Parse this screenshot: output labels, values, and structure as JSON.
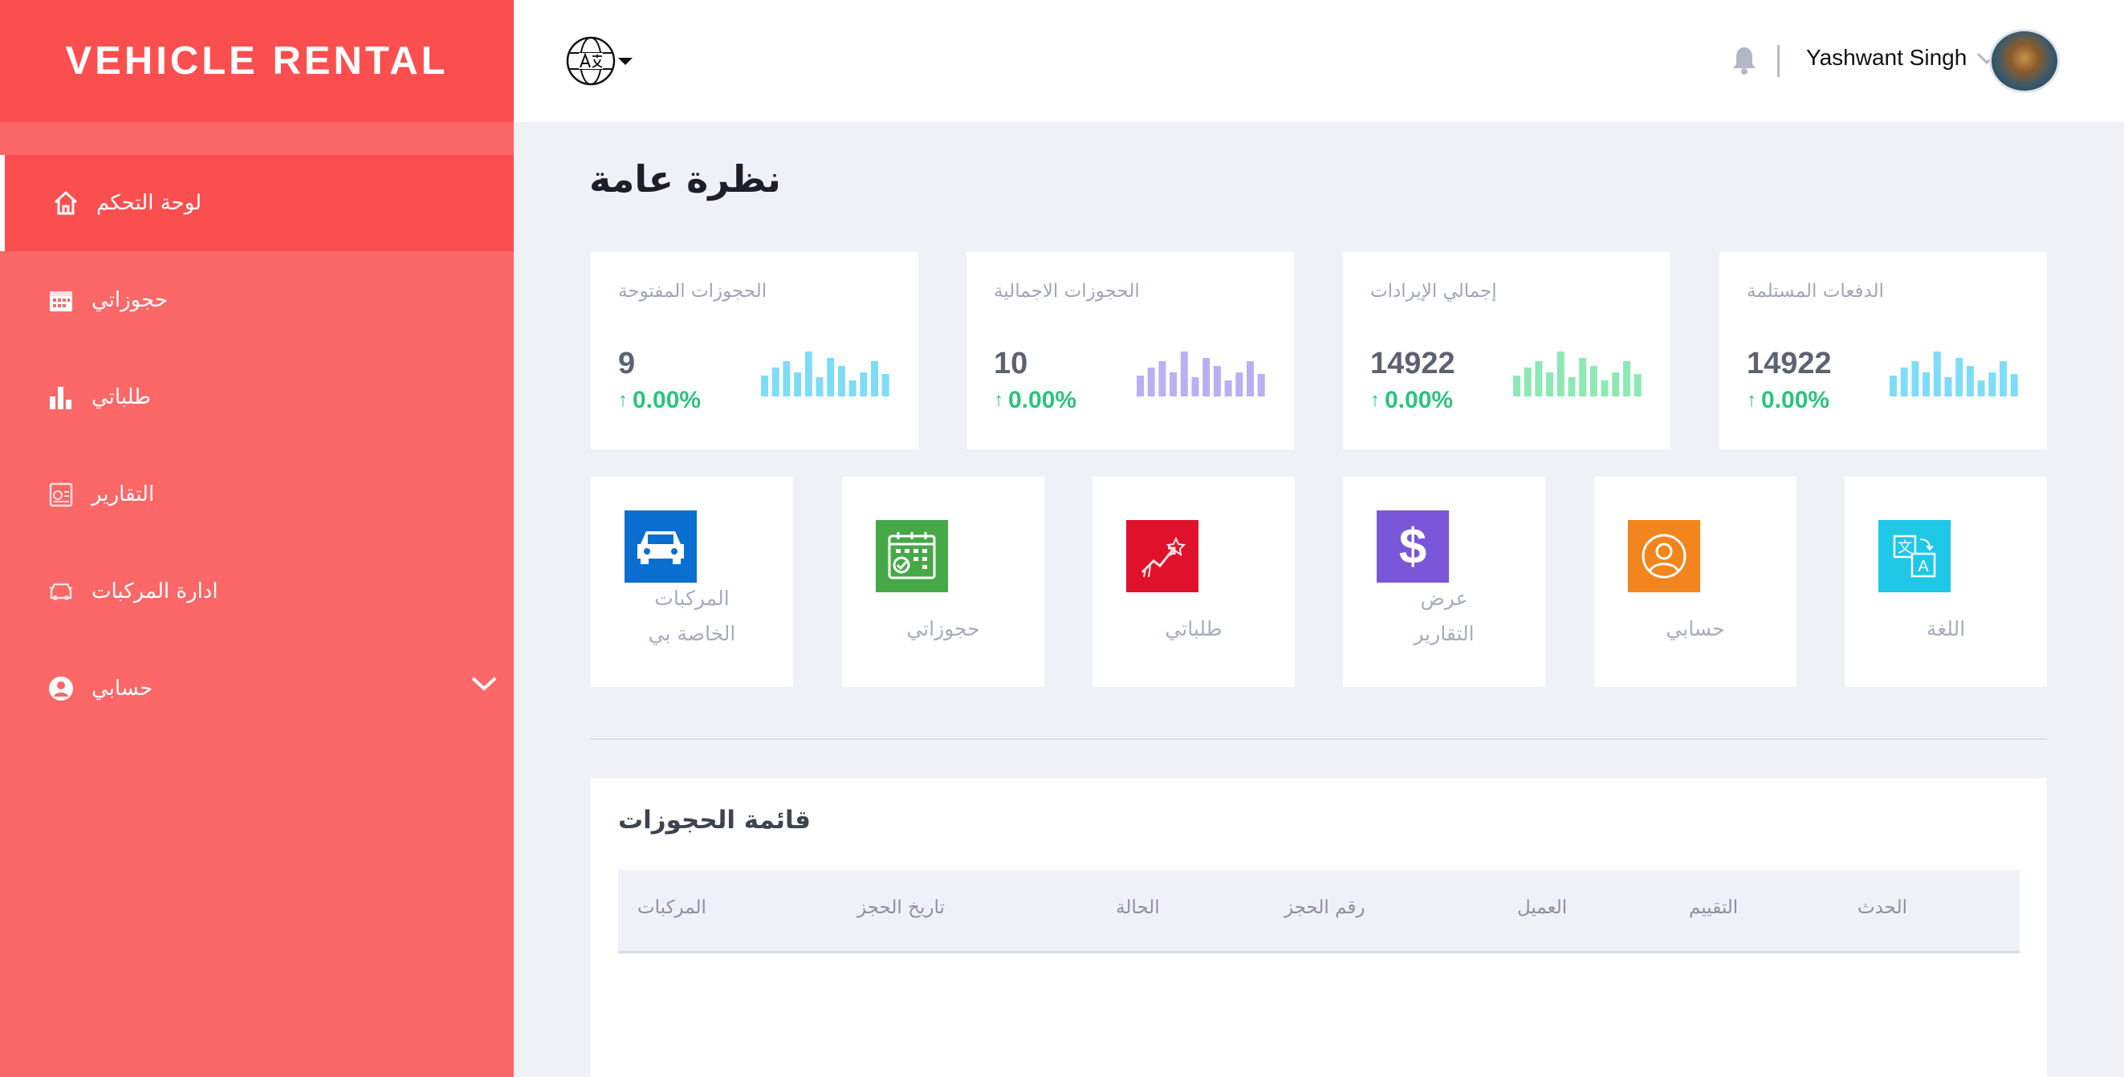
{
  "brand": {
    "title": "VEHICLE RENTAL"
  },
  "sidebar": {
    "items": [
      {
        "label": "لوحة التحكم",
        "icon": "home-icon",
        "active": true
      },
      {
        "label": "حجوزاتي",
        "icon": "calendar-icon"
      },
      {
        "label": "طلباتي",
        "icon": "bar-chart-icon"
      },
      {
        "label": "التقارير",
        "icon": "report-icon"
      },
      {
        "label": "ادارة المركبات",
        "icon": "car-icon"
      },
      {
        "label": "حسابي",
        "icon": "user-circle-icon",
        "expandable": true
      }
    ]
  },
  "topbar": {
    "language_icon": "translate-globe-icon",
    "user_name": "Yashwant Singh"
  },
  "page": {
    "title": "نظرة عامة"
  },
  "stats": [
    {
      "label": "الحجوزات المفتوحة",
      "value": "9",
      "change": "0.00%",
      "color": "#7fdcf7"
    },
    {
      "label": "الحجوزات الاجمالية",
      "value": "10",
      "change": "0.00%",
      "color": "#b9b0f3"
    },
    {
      "label": "إجمالي الإيرادات",
      "value": "14922",
      "change": "0.00%",
      "color": "#8de8b4"
    },
    {
      "label": "الدفعات المستلمة",
      "value": "14922",
      "change": "0.00%",
      "color": "#7fdcf7"
    }
  ],
  "tiles": [
    {
      "line1": "المركبات",
      "line2": "الخاصة بي",
      "icon": "car-icon",
      "color": "#0b6fcf"
    },
    {
      "line1": "حجوزاتي",
      "line2": "",
      "icon": "calendar-check-icon",
      "color": "#47a847"
    },
    {
      "line1": "طلباتي",
      "line2": "",
      "icon": "growth-chart-icon",
      "color": "#e0112b"
    },
    {
      "line1": "عرض",
      "line2": "التقارير",
      "icon": "dollar-icon",
      "color": "#7a57d8"
    },
    {
      "line1": "حسابي",
      "line2": "",
      "icon": "user-circle-icon",
      "color": "#f2851d"
    },
    {
      "line1": "اللغة",
      "line2": "",
      "icon": "translate-icon",
      "color": "#1ec8e6"
    }
  ],
  "bookings_table": {
    "title": "قائمة الحجوزات",
    "columns": [
      "المركبات",
      "تاريخ الحجز",
      "الحالة",
      "رقم الحجز",
      "العميل",
      "التقييم",
      "الحدث"
    ]
  }
}
